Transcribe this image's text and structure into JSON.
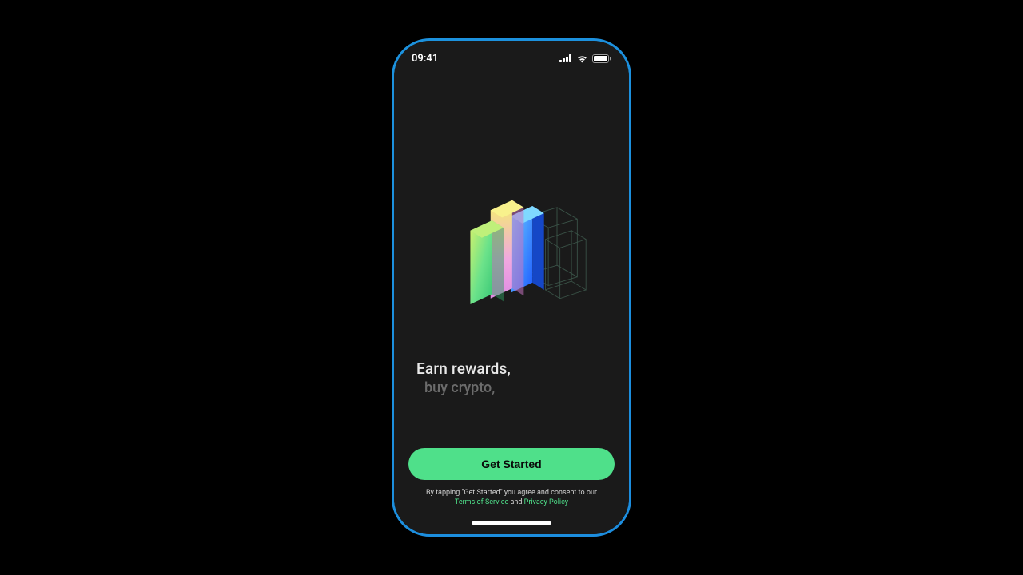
{
  "status": {
    "time": "09:41"
  },
  "headlines": {
    "primary": "Earn rewards,",
    "secondary": "buy crypto,"
  },
  "cta": {
    "label": "Get Started"
  },
  "legal": {
    "prefix": "By tapping \"Get Started\" you agree and consent to our",
    "tos": "Terms of Service",
    "and": " and ",
    "privacy": "Privacy Policy"
  },
  "colors": {
    "accent": "#4fe08a",
    "screen_bg": "#1a1a1a",
    "frame_tint": "#1c8adb"
  }
}
